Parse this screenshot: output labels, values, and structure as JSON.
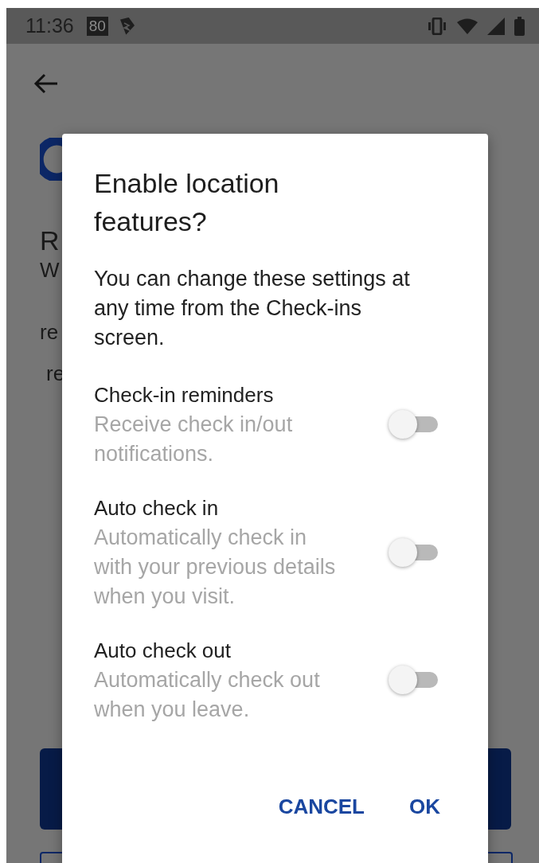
{
  "status_bar": {
    "time": "11:36",
    "badge": "80"
  },
  "background": {
    "heading": "R",
    "text_lines": [
      "W",
      "re"
    ],
    "indented_line": "re"
  },
  "dialog": {
    "title": "Enable location features?",
    "message": "You can change these settings at any time from the Check-ins screen.",
    "settings": [
      {
        "title": "Check-in reminders",
        "description": "Receive check in/out notifications.",
        "on": false
      },
      {
        "title": "Auto check in",
        "description": "Automatically check in with your previous details when you visit.",
        "on": false
      },
      {
        "title": "Auto check out",
        "description": "Automatically check out when you leave.",
        "on": false
      }
    ],
    "buttons": [
      "CANCEL",
      "OK"
    ]
  }
}
